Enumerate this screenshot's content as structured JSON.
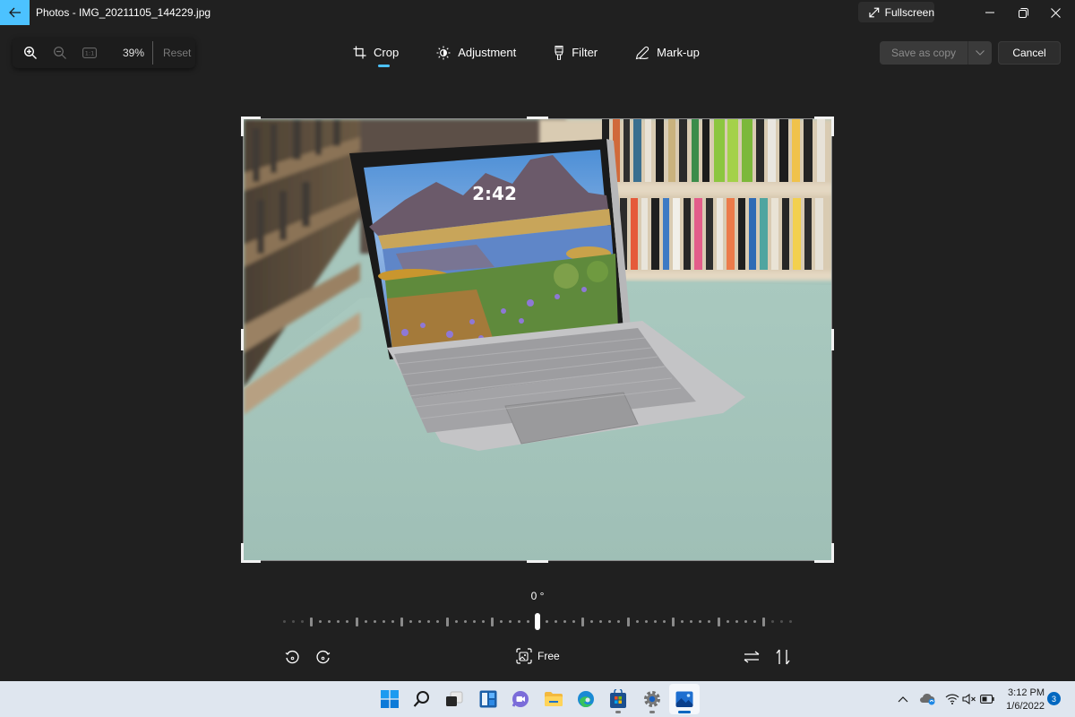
{
  "window": {
    "title": "Photos - IMG_20211105_144229.jpg",
    "fullscreen_label": "Fullscreen",
    "accent_color": "#4cc2ff"
  },
  "zoom_toolbar": {
    "zoom_in_icon": "zoom-in-icon",
    "zoom_out_icon": "zoom-out-icon",
    "actual_size_label": "1:1",
    "zoom_level": "39%",
    "reset_label": "Reset"
  },
  "edit_tabs": [
    {
      "label": "Crop",
      "icon": "crop-icon",
      "active": true
    },
    {
      "label": "Adjustment",
      "icon": "brightness-icon",
      "active": false
    },
    {
      "label": "Filter",
      "icon": "filter-icon",
      "active": false
    },
    {
      "label": "Mark-up",
      "icon": "markup-pen-icon",
      "active": false
    }
  ],
  "actions": {
    "save_label": "Save as copy",
    "cancel_label": "Cancel"
  },
  "photo": {
    "description": "Surface Go tablet with keyboard on a mint table in front of bookshelves",
    "screen_time": "2:42"
  },
  "rotation": {
    "angle_label": "0 °",
    "angle_value": 0,
    "aspect_label": "Free"
  },
  "taskbar": {
    "apps": [
      {
        "name": "start",
        "icon": "windows-start-icon"
      },
      {
        "name": "search",
        "icon": "search-icon"
      },
      {
        "name": "task-view",
        "icon": "task-view-icon"
      },
      {
        "name": "widgets",
        "icon": "widgets-icon"
      },
      {
        "name": "chat",
        "icon": "teams-chat-icon"
      },
      {
        "name": "file-explorer",
        "icon": "folder-icon"
      },
      {
        "name": "edge",
        "icon": "edge-icon"
      },
      {
        "name": "store",
        "icon": "store-icon"
      },
      {
        "name": "settings",
        "icon": "settings-gear-icon"
      },
      {
        "name": "photos",
        "icon": "photos-icon"
      }
    ],
    "time": "3:12 PM",
    "date": "1/6/2022",
    "notification_count": "3"
  }
}
